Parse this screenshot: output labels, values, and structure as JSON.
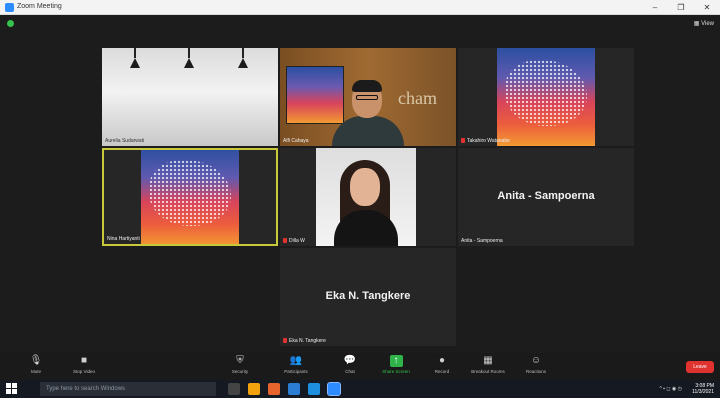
{
  "window": {
    "title": "Zoom Meeting",
    "controls": [
      "–",
      "❐",
      "✕"
    ]
  },
  "meeting": {
    "view_label": "View",
    "participants": [
      {
        "name": "Aurelia Sudarwati",
        "type": "room"
      },
      {
        "name": "Alfi Cahaya",
        "type": "office"
      },
      {
        "name": "Takahiro Watanabe",
        "type": "map",
        "muted": true
      },
      {
        "name": "Nina Hartiyanti",
        "type": "map",
        "active": true
      },
      {
        "name": "Dilla W",
        "type": "woman",
        "muted": true
      },
      {
        "name": "Anita - Sampoerna",
        "type": "name",
        "big": "Anita - Sampoerna"
      },
      {
        "name": "Eka N. Tangkere",
        "type": "name",
        "big": "Eka N. Tangkere",
        "muted": true
      }
    ],
    "office_sign": "cham"
  },
  "toolbar": {
    "items": [
      {
        "label": "Mute",
        "icon": "microphone-icon"
      },
      {
        "label": "Stop Video",
        "icon": "video-camera-icon"
      },
      {
        "label": "Security",
        "icon": "shield-icon"
      },
      {
        "label": "Participants",
        "icon": "participants-icon",
        "count": "7"
      },
      {
        "label": "Chat",
        "icon": "chat-icon"
      },
      {
        "label": "Share Screen",
        "icon": "share-screen-icon"
      },
      {
        "label": "Record",
        "icon": "record-icon"
      },
      {
        "label": "Breakout Rooms",
        "icon": "breakout-rooms-icon"
      },
      {
        "label": "Reactions",
        "icon": "reactions-icon"
      }
    ],
    "end_label": "Leave"
  },
  "taskbar": {
    "search_placeholder": "Type here to search Windows",
    "time": "3:08 PM",
    "date": "11/3/2021"
  },
  "colors": {
    "accent_green": "#35c24a",
    "active_speaker": "#c7c83a",
    "end_red": "#e0322f"
  }
}
